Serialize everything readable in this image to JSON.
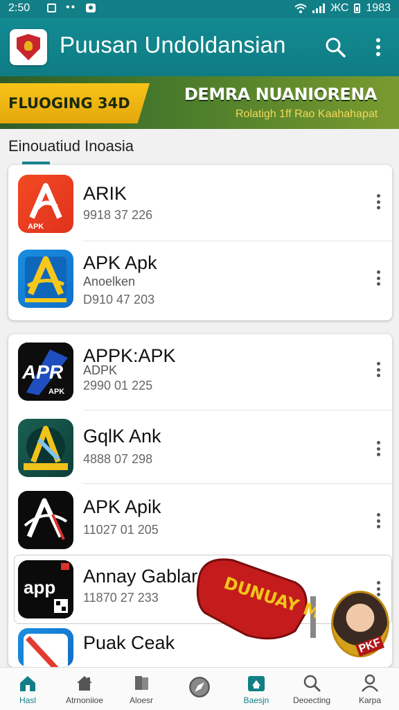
{
  "status_bar": {
    "time": "2:50",
    "right_text": "ЖC",
    "battery_text": "1983"
  },
  "app_bar": {
    "title": "Puusan Undoldansian",
    "logo_icon": "crest-logo-icon",
    "search_icon": "search-icon",
    "menu_icon": "more-vert-icon"
  },
  "banner": {
    "left_text": "FLUOGING 34D",
    "title": "DEMRA NUANIORENA",
    "subtitle": "Rolatigh 1ff Rao Kaahahapat",
    "accent": "#f7c419"
  },
  "section": {
    "title": "Einouatiud Inoasia"
  },
  "apps": [
    {
      "name": "ARIK",
      "sub": "",
      "meta": "9918 37 226",
      "icon": "apk-orange-icon",
      "icon_label": "APK"
    },
    {
      "name": "APK Apk",
      "sub": "Anoelken",
      "meta": "D910 47 203",
      "icon": "apk-blue-icon",
      "icon_label": ""
    },
    {
      "name": "APPK:APK",
      "sub": "ADPK",
      "meta": "2990 01 225",
      "icon": "apr-black-icon",
      "icon_label": "APK"
    },
    {
      "name": "GqlK Ank",
      "sub": "",
      "meta": "4888 07 298",
      "icon": "apk-teal-icon",
      "icon_label": ""
    },
    {
      "name": "APK Apik",
      "sub": "",
      "meta": "11027 01 205",
      "icon": "apk-dark-icon",
      "icon_label": ""
    },
    {
      "name": "Annay Gablar",
      "sub": "",
      "meta": "11870 27 233",
      "icon": "app-black-icon",
      "icon_label": "app"
    },
    {
      "name": "Puak Ceak",
      "sub": "",
      "meta": "",
      "icon": "slash-blue-icon",
      "icon_label": ""
    }
  ],
  "sticker": {
    "text": "DUNUAY MOMIN",
    "badge_text": "PKF"
  },
  "bottom_nav": [
    {
      "label": "Hasl",
      "icon": "home-icon",
      "active": true
    },
    {
      "label": "Atrnoniioe",
      "icon": "house-icon",
      "active": false
    },
    {
      "label": "Aloesr",
      "icon": "book-icon",
      "active": false
    },
    {
      "label": "",
      "icon": "compass-icon",
      "active": false
    },
    {
      "label": "Baesjn",
      "icon": "store-icon",
      "active": true
    },
    {
      "label": "Deoecting",
      "icon": "search-icon",
      "active": false
    },
    {
      "label": "Karpa",
      "icon": "person-icon",
      "active": false
    }
  ],
  "colors": {
    "primary": "#127f86",
    "background": "#f1f1f1"
  }
}
